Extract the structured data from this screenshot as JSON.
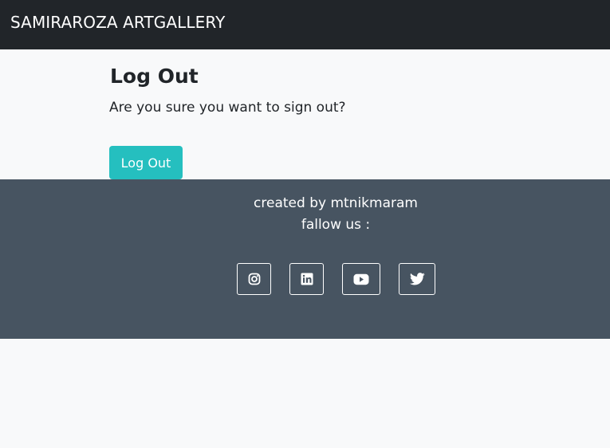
{
  "navbar": {
    "brand": "SAMIRAROZA ARTGALLERY"
  },
  "main": {
    "title": "Log Out",
    "question": "Are you sure you want to sign out?",
    "logout_label": "Log Out"
  },
  "footer": {
    "credit": "created by mtnikmaram",
    "follow": "fallow us :",
    "socials": [
      "instagram-icon",
      "linkedin-icon",
      "youtube-icon",
      "twitter-icon"
    ]
  },
  "colors": {
    "navbar": "#212529",
    "page_background": "#f8f9fa",
    "accent_button": "#25bfbf",
    "footer": "#475461",
    "text": "#212529"
  }
}
